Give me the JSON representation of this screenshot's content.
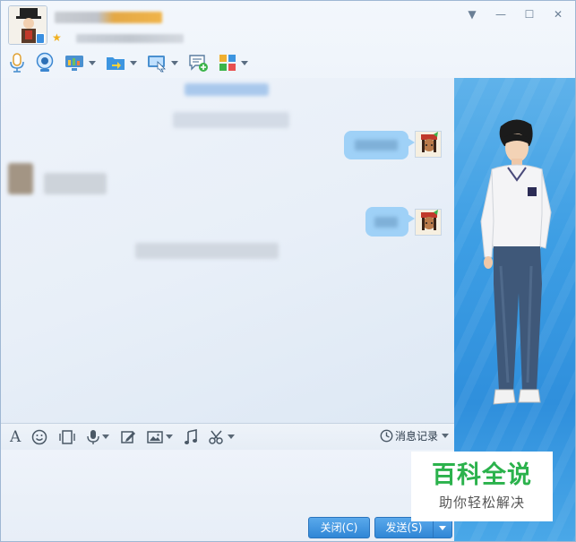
{
  "window": {
    "controls": {
      "menu_glyph": "▼",
      "minimize_glyph": "—",
      "maximize_glyph": "☐",
      "close_glyph": "✕"
    }
  },
  "header": {
    "vip_glyph": "★"
  },
  "toolbar": {
    "items": [
      {
        "icon": "microphone-icon"
      },
      {
        "icon": "webcam-icon"
      },
      {
        "icon": "screen-share-icon"
      },
      {
        "icon": "file-transfer-icon"
      },
      {
        "icon": "remote-desktop-icon"
      },
      {
        "icon": "add-chat-icon"
      },
      {
        "icon": "apps-grid-icon"
      }
    ]
  },
  "input_toolbar": {
    "font_glyph": "A",
    "history_label": "消息记录"
  },
  "buttons": {
    "close_label": "关闭(C)",
    "send_label": "发送(S)"
  },
  "watermark": {
    "title": "百科全说",
    "subtitle": "助你轻松解决"
  },
  "colors": {
    "accent": "#2f86d6",
    "bubble": "#9fd1f7",
    "side_panel": "#3d9ee4",
    "watermark_green": "#2bb24c"
  }
}
